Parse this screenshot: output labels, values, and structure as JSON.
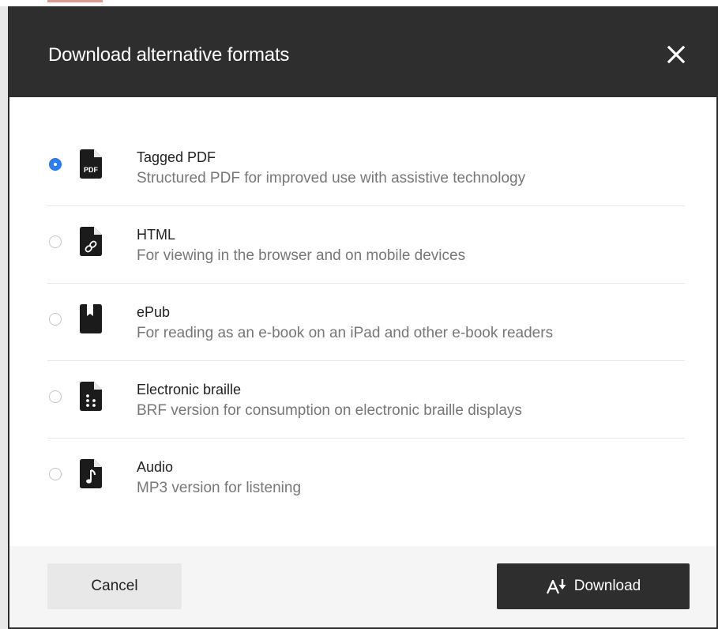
{
  "dialog": {
    "title": "Download alternative formats",
    "close_label": "×"
  },
  "options": [
    {
      "title": "Tagged PDF",
      "description": "Structured PDF for improved use with assistive technology",
      "icon": "pdf-file-icon",
      "selected": true,
      "icon_text": "PDF"
    },
    {
      "title": "HTML",
      "description": "For viewing in the browser and on mobile devices",
      "icon": "link-file-icon",
      "selected": false
    },
    {
      "title": "ePub",
      "description": "For reading as an e-book on an iPad and other e-book readers",
      "icon": "book-icon",
      "selected": false
    },
    {
      "title": "Electronic braille",
      "description": "BRF version for consumption on electronic braille displays",
      "icon": "braille-file-icon",
      "selected": false
    },
    {
      "title": "Audio",
      "description": "MP3 version for listening",
      "icon": "audio-file-icon",
      "selected": false
    }
  ],
  "footer": {
    "cancel_label": "Cancel",
    "download_label": "Download"
  },
  "colors": {
    "header_bg": "#2e2e2e",
    "radio_selected": "#2d7ff0",
    "description_text": "#777777"
  }
}
